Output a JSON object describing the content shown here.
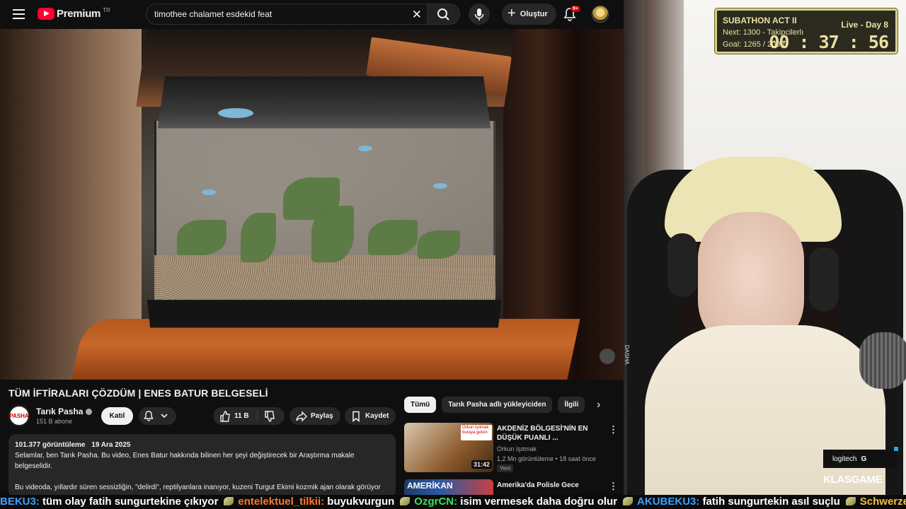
{
  "header": {
    "brand": "Premium",
    "country": "TR",
    "search_value": "timothee chalamet esdekid feat",
    "create_label": "Oluştur",
    "notif_count": "9+"
  },
  "video": {
    "title": "TÜM İFTİRALARI ÇÖZDÜM | ENES BATUR BELGESELİ"
  },
  "channel": {
    "avatar_text": "PASHA",
    "name": "Tarık Pasha",
    "subs": "151 B abone",
    "join_label": "Katıl"
  },
  "actions": {
    "likes": "11 B",
    "share": "Paylaş",
    "save": "Kaydet"
  },
  "description": {
    "views": "101.377 görüntüleme",
    "date": "19 Ara 2025",
    "line1": "Selamlar, ben Tarık Pasha. Bu video, Enes Batur hakkında bilinen her şeyi değiştirecek bir Araştırma makale belgeselidir.",
    "line2": "Bu videoda, yıllardır süren sessizliğin, \"delirdi\", reptilyanlara inanıyor, kuzeni Turgut Ekimi kozmik ajan olarak görüyor"
  },
  "chips": [
    "Tümü",
    "Tarık Pasha adlı yükleyiciden",
    "İlgili"
  ],
  "related": [
    {
      "title": "AKDENİZ BÖLGESİ'NİN EN DÜŞÜK PUANLI ...",
      "channel": "Orkun Işıtmak",
      "views": "1,2 Mn görüntüleme",
      "age": "18 saat önce",
      "badge": "Yeni",
      "duration": "31:42",
      "thumb_badge": "Orkun Işıtmak buraya gelsin"
    },
    {
      "title": "Amerika'da Polisle Gece",
      "thumb_text": "AMERİKAN"
    }
  ],
  "overlay": {
    "subathon_title": "SUBATHON ACT II",
    "live_day": "Live - Day 8",
    "next": "Next: 1300 - Takipcilerlı",
    "goal": "Goal: 1265 / 2000",
    "timer": "00 : 37 : 56",
    "sponsor": "logitech",
    "sponsor_mark": "G",
    "klas": "KLAS",
    "game": "GAME",
    "vertical_text": "DASHA"
  },
  "ticker": [
    {
      "user": "BEKU3:",
      "msg": "tüm olay fatih sungurtekine çıkıyor",
      "color": "#3ca0ff"
    },
    {
      "user": "entelektuel_tilkii:",
      "msg": "buyukvurgun",
      "color": "#ff7a2e"
    },
    {
      "user": "OzgrCN:",
      "msg": "isim vermesek daha doğru olur",
      "color": "#3ee05a"
    },
    {
      "user": "AKUBEKU3:",
      "msg": "fatih sungurtekin asıl suçlu",
      "color": "#3ca0ff"
    },
    {
      "user": "Schwerze:",
      "msg": "",
      "color": "#f0c040"
    }
  ],
  "colors": {
    "yt_red": "#ff0033",
    "overlay_gold": "#d9cf86"
  }
}
